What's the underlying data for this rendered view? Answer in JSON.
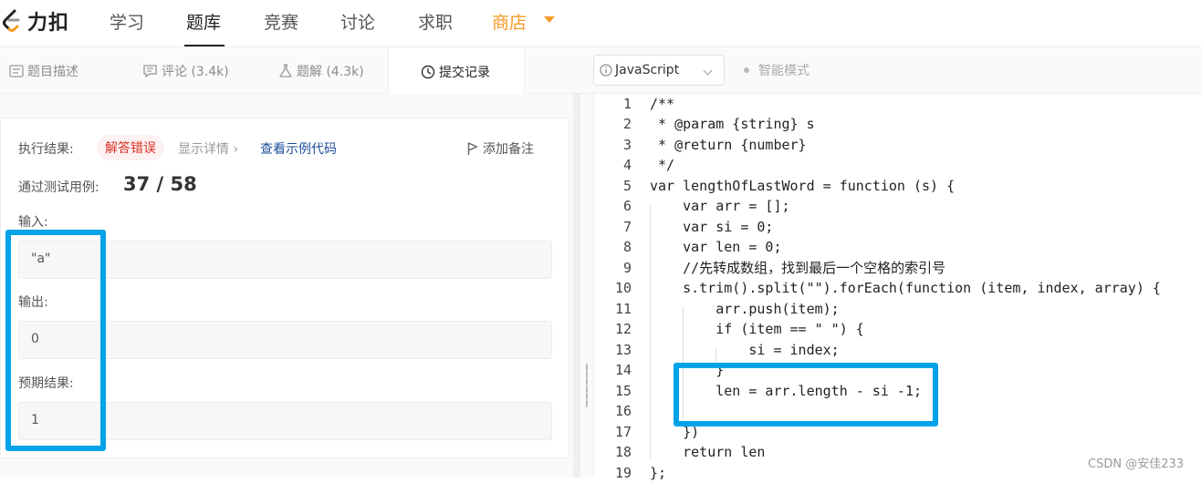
{
  "nav": {
    "logo_text": "力扣",
    "items": [
      "学习",
      "题库",
      "竞赛",
      "讨论",
      "求职"
    ],
    "store": "商店",
    "active": "题库"
  },
  "tabs": [
    {
      "label": "题目描述",
      "icon": "description-icon"
    },
    {
      "label": "评论 (3.4k)",
      "icon": "comment-icon"
    },
    {
      "label": "题解 (4.3k)",
      "icon": "flask-icon"
    },
    {
      "label": "提交记录",
      "icon": "clock-icon",
      "active": true
    }
  ],
  "editor_toolbar": {
    "language": "JavaScript",
    "smart_mode": "智能模式"
  },
  "result": {
    "exec_label": "执行结果:",
    "status": "解答错误",
    "show_detail": "显示详情",
    "view_example": "查看示例代码",
    "add_note": "添加备注",
    "pass_label": "通过测试用例:",
    "pass_count": "37 / 58",
    "input_label": "输入:",
    "input_value": "\"a\"",
    "output_label": "输出:",
    "output_value": "0",
    "expected_label": "预期结果:",
    "expected_value": "1"
  },
  "code": {
    "line_numbers": [
      "1",
      "2",
      "3",
      "4",
      "5",
      "6",
      "7",
      "8",
      "9",
      "10",
      "11",
      "12",
      "13",
      "14",
      "15",
      "16",
      "17",
      "18",
      "19"
    ],
    "line_1": "/**",
    "line_2": " * @param {string} s",
    "line_3": " * @return {number}",
    "line_4": " */",
    "line_5": "var lengthOfLastWord = function (s) {",
    "line_6": "    var arr = [];",
    "line_7": "    var si = 0;",
    "line_8": "    var len = 0;",
    "line_9": "    //先转成数组，找到最后一个空格的索引号",
    "line_10": "    s.trim().split(\"\").forEach(function (item, index, array) {",
    "line_11": "        arr.push(item);",
    "line_12": "        if (item == \" \") {",
    "line_13": "            si = index;",
    "line_14": "        }",
    "line_15": "        len = arr.length - si -1;",
    "line_16": "",
    "line_17": "    })",
    "line_18": "    return len",
    "line_19": "};"
  },
  "watermark": "CSDN @安佳233",
  "colors": {
    "accent_store": "#f59a23",
    "error_red": "#d93025",
    "link_blue": "#1f4e9a",
    "annotation_box": "#00a2e8"
  }
}
